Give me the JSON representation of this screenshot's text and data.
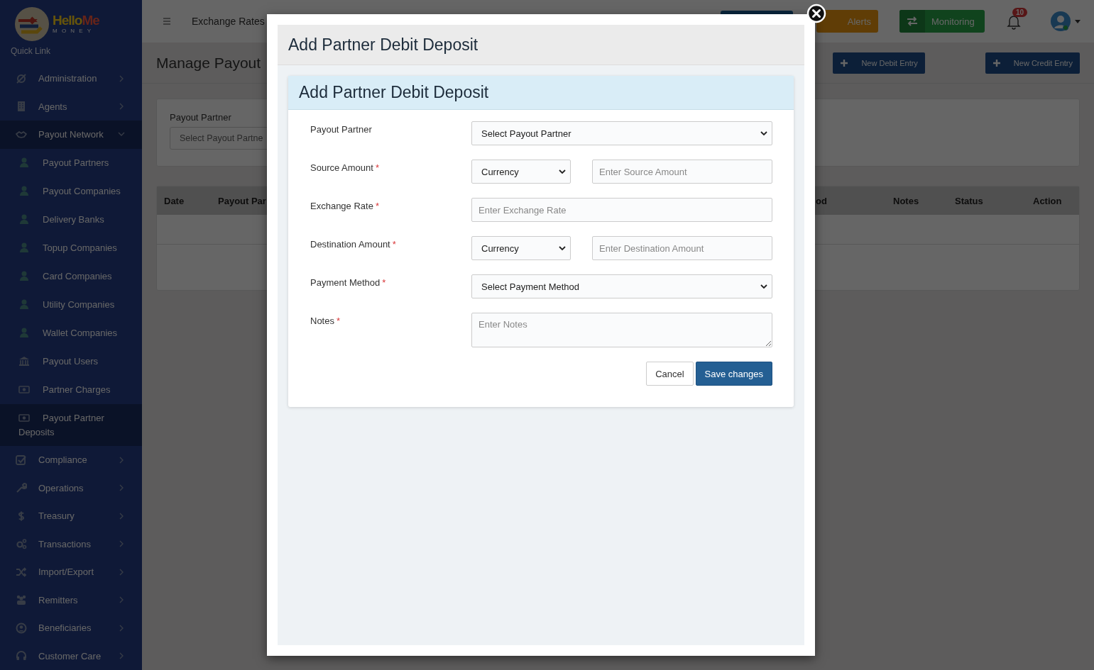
{
  "logo": {
    "name_part_1": "Hello",
    "name_part_2": "Me",
    "subtitle": "M O N E Y"
  },
  "sidebar": {
    "heading": "Quick Link",
    "items": [
      {
        "label": "Administration",
        "expanded": false
      },
      {
        "label": "Agents",
        "expanded": false
      },
      {
        "label": "Payout Network",
        "expanded": true,
        "children": [
          {
            "label": "Payout Partners",
            "selected": false
          },
          {
            "label": "Payout Companies",
            "selected": false
          },
          {
            "label": "Delivery Banks",
            "selected": false
          },
          {
            "label": "Topup Companies",
            "selected": false
          },
          {
            "label": "Card Companies",
            "selected": false
          },
          {
            "label": "Utility Companies",
            "selected": false
          },
          {
            "label": "Wallet Companies",
            "selected": false
          },
          {
            "label": "Payout Users",
            "selected": false
          },
          {
            "label": "Partner Charges",
            "selected": false
          },
          {
            "label": "Payout Partner Deposits",
            "selected": true
          }
        ]
      },
      {
        "label": "Compliance",
        "expanded": false
      },
      {
        "label": "Operations",
        "expanded": false
      },
      {
        "label": "Treasury",
        "expanded": false
      },
      {
        "label": "Transactions",
        "expanded": false
      },
      {
        "label": "Import/Export",
        "expanded": false
      },
      {
        "label": "Remitters",
        "expanded": false
      },
      {
        "label": "Beneficiaries",
        "expanded": false
      },
      {
        "label": "Customer Care",
        "expanded": false
      }
    ]
  },
  "topbar": {
    "menu_label": "Exchange Rates",
    "alerts_button": "Alerts",
    "monitoring_button": "Monitoring",
    "notification_count": "10"
  },
  "page": {
    "title": "Manage Payout",
    "buttons": [
      "New Debit Entry",
      "New Credit Entry"
    ],
    "filter": {
      "label": "Payout Partner",
      "placeholder": "Select Payout Partne"
    },
    "table": {
      "columns": [
        "Date",
        "Payout Par",
        "od",
        "Notes",
        "Status",
        "Action"
      ]
    }
  },
  "modal": {
    "title": "Add Partner Debit Deposit",
    "card_title": "Add Partner Debit Deposit",
    "fields": [
      {
        "kind": "select",
        "label": "Payout Partner",
        "value": "Select Payout Partner"
      },
      {
        "kind": "currency_amount",
        "label": "Source Amount",
        "required_mark": "*",
        "currency": "Currency",
        "placeholder": "Enter Source Amount"
      },
      {
        "kind": "input",
        "label": "Exchange Rate",
        "required_mark": "*",
        "placeholder": "Enter Exchange Rate"
      },
      {
        "kind": "currency_amount",
        "label": "Destination Amount",
        "required_mark": "*",
        "currency": "Currency",
        "placeholder": "Enter Destination Amount"
      },
      {
        "kind": "select",
        "label": "Payment Method",
        "required_mark": "*",
        "value": "Select Payment Method"
      },
      {
        "kind": "textarea",
        "label": "Notes",
        "required_mark": "*",
        "placeholder": "Enter Notes"
      }
    ],
    "cancel_button": "Cancel",
    "save_button": "Save changes"
  }
}
